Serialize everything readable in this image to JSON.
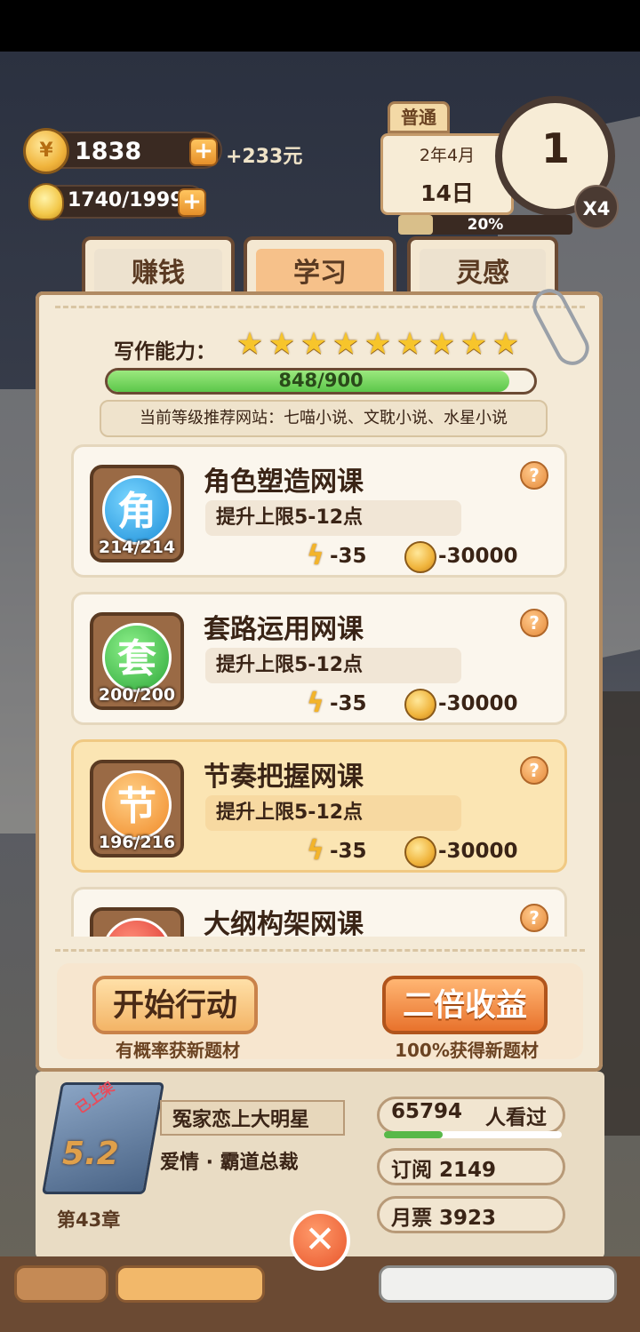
{
  "hud": {
    "coins": "1838",
    "income": "+233元",
    "energy": "1740/1999",
    "mode": "普通",
    "date_year_month": "2年4月",
    "date_day": "14日",
    "clock_value": "1",
    "speed": "X4",
    "day_progress_text": "20%",
    "day_progress": 0.2
  },
  "tabs": [
    {
      "label": "赚钱"
    },
    {
      "label": "学习"
    },
    {
      "label": "灵感"
    }
  ],
  "ability": {
    "label": "写作能力：",
    "stars": 9,
    "xp_text": "848/900",
    "xp_current": 848,
    "xp_max": 900,
    "recommend": "当前等级推荐网站：七喵小说、文耽小说、水星小说"
  },
  "courses": [
    {
      "icon_char": "角",
      "count": "214/214",
      "title": "角色塑造网课",
      "desc": "提升上限5-12点",
      "energy_cost": "-35",
      "coin_cost": "-30000"
    },
    {
      "icon_char": "套",
      "count": "200/200",
      "title": "套路运用网课",
      "desc": "提升上限5-12点",
      "energy_cost": "-35",
      "coin_cost": "-30000"
    },
    {
      "icon_char": "节",
      "count": "196/216",
      "title": "节奏把握网课",
      "desc": "提升上限5-12点",
      "energy_cost": "-35",
      "coin_cost": "-30000"
    },
    {
      "title": "大纲构架网课"
    }
  ],
  "actions": {
    "start_label": "开始行动",
    "start_sub": "有概率获新题材",
    "double_label": "二倍收益",
    "double_sub": "100%获得新题材"
  },
  "book": {
    "tag": "已上架",
    "score": "5.2",
    "name": "冤家恋上大明星",
    "genre": "爱情 · 霸道总裁",
    "chapter": "第43章",
    "views_count": "65794",
    "views_label": "人看过",
    "subscriptions": "订阅 2149",
    "monthly_tickets": "月票 3923"
  },
  "colors": {
    "tab_active": "#f6c18a",
    "xp_green": "#5cc74a",
    "primary_button": "#e8722c"
  }
}
